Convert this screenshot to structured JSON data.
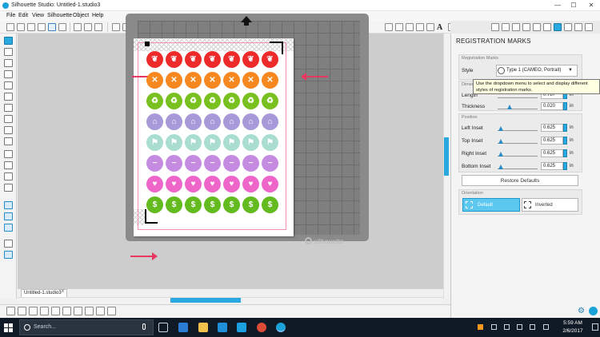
{
  "window": {
    "title": "Silhouette Studio: Untitled-1.studio3",
    "minimize": "—",
    "maximize": "☐",
    "close": "✕"
  },
  "menu": [
    "File",
    "Edit",
    "View",
    "Silhouette",
    "Object",
    "Help"
  ],
  "document_tab": {
    "label": "Untitled-1.studio3",
    "close": "x"
  },
  "mat": {
    "brand": "silhouette"
  },
  "panel": {
    "title": "REGISTRATION MARKS",
    "sections": {
      "registration_marks": "Registration Marks",
      "dimensions": "Dimensions",
      "position": "Position",
      "orientation": "Orientation"
    },
    "style_label": "Style",
    "style_value": "Type 1 (CAMEO, Portrait)",
    "style_arrow": "▼",
    "length_label": "Length",
    "length_value": "0.787",
    "thickness_label": "Thickness",
    "thickness_value": "0.020",
    "left_inset_label": "Left Inset",
    "left_inset_value": "0.625",
    "top_inset_label": "Top Inset",
    "top_inset_value": "0.625",
    "right_inset_label": "Right Inset",
    "right_inset_value": "0.625",
    "bottom_inset_label": "Bottom Inset",
    "bottom_inset_value": "0.625",
    "unit": "in",
    "restore_label": "Restore Defaults",
    "orientation_default": "Default",
    "orientation_inverted": "Inverted",
    "tooltip": "Use the dropdown menu to select and display different styles of registration marks."
  },
  "sticker_rows": [
    {
      "color": "#ee2b2b",
      "glyphs": [
        "❦",
        "❦",
        "❦",
        "❦",
        "❦",
        "❦",
        "❦"
      ]
    },
    {
      "color": "#f6881f",
      "glyphs": [
        "✕",
        "✕",
        "✕",
        "✕",
        "✕",
        "✕",
        "✕"
      ]
    },
    {
      "color": "#79c11f",
      "glyphs": [
        "♻",
        "♻",
        "♻",
        "♻",
        "♻",
        "♻",
        "♻"
      ]
    },
    {
      "color": "#a89ad8",
      "glyphs": [
        "⌂",
        "⌂",
        "⌂",
        "⌂",
        "⌂",
        "⌂",
        "⌂"
      ]
    },
    {
      "color": "#a9ddd0",
      "glyphs": [
        "⚑",
        "⚑",
        "⚑",
        "⚑",
        "⚑",
        "⚑",
        "⚑"
      ]
    },
    {
      "color": "#c58be0",
      "glyphs": [
        "−",
        "−",
        "−",
        "−",
        "−",
        "−",
        "−"
      ]
    },
    {
      "color": "#ee66c9",
      "glyphs": [
        "♥",
        "♥",
        "♥",
        "♥",
        "♥",
        "♥",
        "♥"
      ]
    },
    {
      "color": "#64bb1f",
      "glyphs": [
        "$",
        "$",
        "$",
        "$",
        "$",
        "$",
        "$"
      ]
    }
  ],
  "taskbar": {
    "search_placeholder": "Search...",
    "time": "5:59 AM",
    "date": "2/6/2017"
  }
}
